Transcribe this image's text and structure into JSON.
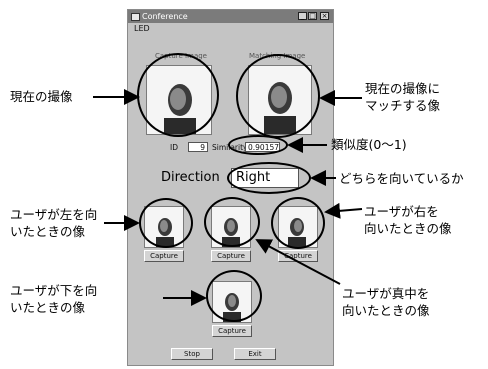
{
  "window": {
    "title": "Conference",
    "menu": [
      "LED"
    ],
    "capture_label": "Capture Image",
    "matching_label": "Matching Image",
    "id_label": "ID",
    "id_value": "9",
    "similarity_label": "Similarity",
    "similarity_value": "0.90157",
    "direction_label": "Direction",
    "direction_value": "Right",
    "capture_buttons": [
      "Capture",
      "Capture",
      "Capture",
      "Capture"
    ],
    "stop_label": "Stop",
    "exit_label": "Exit"
  },
  "annotations": {
    "current_image": "現在の撮像",
    "matching_image": [
      "現在の撮像に",
      "マッチする像"
    ],
    "similarity": "類似度(0～1)",
    "direction": "どちらを向いているか",
    "left": [
      "ユーザが左を向",
      "いたときの像"
    ],
    "right": [
      "ユーザが右を",
      "向いたときの像"
    ],
    "down": [
      "ユーザが下を向",
      "いたときの像"
    ],
    "center": [
      "ユーザが真中を",
      "向いたときの像"
    ]
  }
}
